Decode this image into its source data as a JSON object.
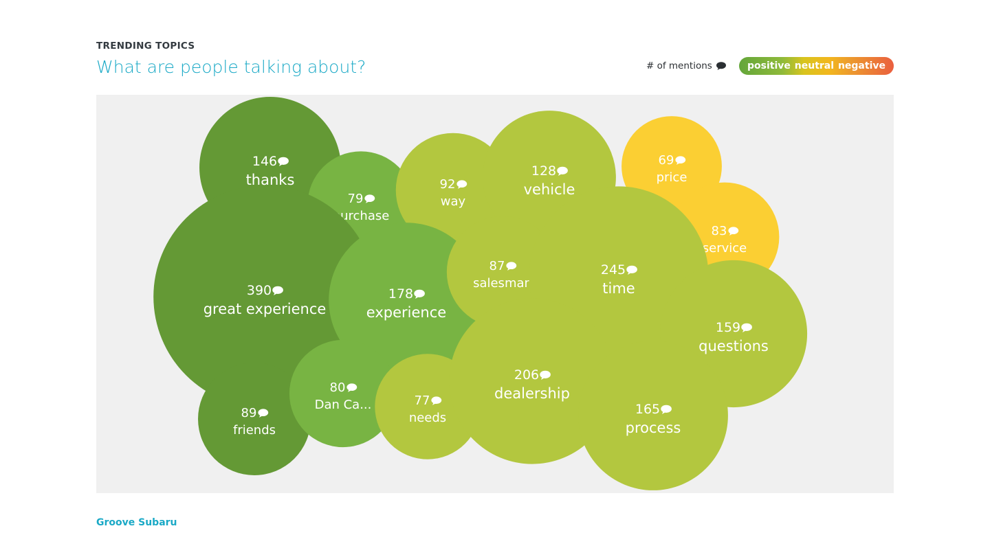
{
  "header": {
    "eyebrow": "TRENDING TOPICS",
    "title": "What are people talking about?"
  },
  "legend": {
    "mentions_label": "# of mentions",
    "mentions_icon": "speech-bubble-icon",
    "sentiment": [
      "positive",
      "neutral",
      "negative"
    ]
  },
  "colors": {
    "positive_dark": "#649935",
    "positive": "#78b443",
    "positive_light": "#b3c73f",
    "neutral": "#fbcf33",
    "negative": "#ea5f3f",
    "title": "#1aa9c6"
  },
  "chart_data": {
    "type": "bubble",
    "title": "",
    "size_metric": "# of mentions",
    "color_metric": "sentiment",
    "topics": [
      {
        "label": "thanks",
        "mentions": 146,
        "sentiment": "positive",
        "shade": "#649935"
      },
      {
        "label": "purchase",
        "mentions": 79,
        "sentiment": "positive",
        "shade": "#78b443"
      },
      {
        "label": "way",
        "mentions": 92,
        "sentiment": "positive",
        "shade": "#b3c73f"
      },
      {
        "label": "vehicle",
        "mentions": 128,
        "sentiment": "positive",
        "shade": "#b3c73f"
      },
      {
        "label": "price",
        "mentions": 69,
        "sentiment": "neutral",
        "shade": "#fbcf33"
      },
      {
        "label": "service",
        "mentions": 83,
        "sentiment": "neutral",
        "shade": "#fbcf33"
      },
      {
        "label": "great experience",
        "mentions": 390,
        "sentiment": "positive",
        "shade": "#649935"
      },
      {
        "label": "experience",
        "mentions": 178,
        "sentiment": "positive",
        "shade": "#78b443"
      },
      {
        "label": "salesman",
        "mentions": 87,
        "sentiment": "positive",
        "shade": "#b3c73f"
      },
      {
        "label": "time",
        "mentions": 245,
        "sentiment": "positive",
        "shade": "#b3c73f"
      },
      {
        "label": "questions",
        "mentions": 159,
        "sentiment": "positive",
        "shade": "#b3c73f"
      },
      {
        "label": "friends",
        "mentions": 89,
        "sentiment": "positive",
        "shade": "#649935"
      },
      {
        "label": "Dan Ca...",
        "mentions": 80,
        "sentiment": "positive",
        "shade": "#78b443"
      },
      {
        "label": "needs",
        "mentions": 77,
        "sentiment": "positive",
        "shade": "#b3c73f"
      },
      {
        "label": "dealership",
        "mentions": 206,
        "sentiment": "positive",
        "shade": "#b3c73f"
      },
      {
        "label": "process",
        "mentions": 165,
        "sentiment": "positive",
        "shade": "#b3c73f"
      }
    ]
  },
  "footer": {
    "brand": "Groove Subaru"
  }
}
